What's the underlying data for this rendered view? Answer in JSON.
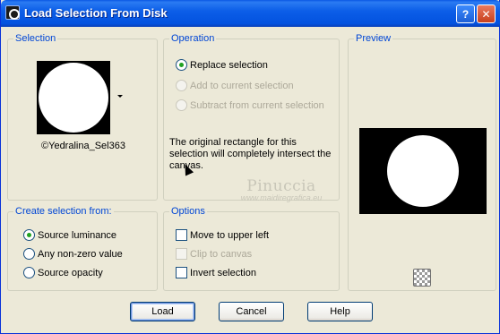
{
  "window": {
    "title": "Load Selection From Disk",
    "help_label": "?",
    "close_label": "✕"
  },
  "selection": {
    "label": "Selection",
    "selected_name": "©Yedralina_Sel363"
  },
  "operation": {
    "label": "Operation",
    "options": [
      {
        "label": "Replace selection",
        "checked": true,
        "enabled": true
      },
      {
        "label": "Add to current selection",
        "checked": false,
        "enabled": false
      },
      {
        "label": "Subtract from current selection",
        "checked": false,
        "enabled": false
      }
    ],
    "description": "The original rectangle for this selection will completely intersect the canvas."
  },
  "preview": {
    "label": "Preview"
  },
  "create_from": {
    "label": "Create selection from:",
    "options": [
      {
        "label": "Source luminance",
        "checked": true
      },
      {
        "label": "Any non-zero value",
        "checked": false
      },
      {
        "label": "Source opacity",
        "checked": false
      }
    ]
  },
  "options": {
    "label": "Options",
    "items": [
      {
        "label": "Move to upper left",
        "checked": false,
        "enabled": true
      },
      {
        "label": "Clip to canvas",
        "checked": false,
        "enabled": false
      },
      {
        "label": "Invert selection",
        "checked": false,
        "enabled": true
      }
    ]
  },
  "watermark": {
    "name": "Pinuccia",
    "url": "www.maidiregrafica.eu"
  },
  "buttons": {
    "load": "Load",
    "cancel": "Cancel",
    "help": "Help"
  }
}
